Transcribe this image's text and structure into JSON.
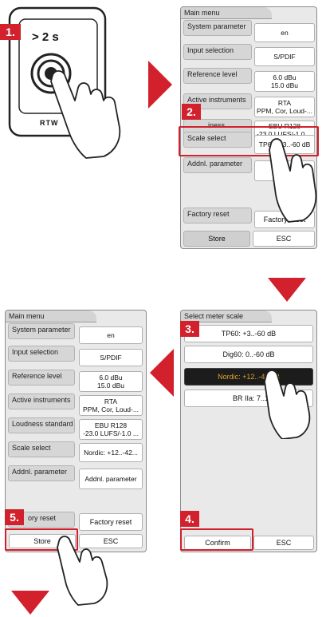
{
  "device": {
    "hold_label": "> 2 s",
    "brand": "RTW"
  },
  "steps": {
    "s1": "1.",
    "s2": "2.",
    "s3": "3.",
    "s4a": "4.",
    "s4b": "4.",
    "s5": "5."
  },
  "screen1": {
    "title": "Main menu",
    "rows": [
      {
        "label": "System parameter",
        "value": [
          "en"
        ]
      },
      {
        "label": "Input selection",
        "value": [
          "S/PDIF"
        ]
      },
      {
        "label": "Reference level",
        "value": [
          "6.0 dBu",
          "15.0 dBu"
        ]
      },
      {
        "label": "Active instruments",
        "value": [
          "RTA",
          "PPM, Cor, Loud-..."
        ]
      },
      {
        "label": "iness standard",
        "value": [
          "EBU R128",
          "-23.0 LUFS/-1.0 ..."
        ]
      },
      {
        "label": "Scale select",
        "value": [
          "TP60: +3..-60 dB"
        ]
      },
      {
        "label": "Addnl. parameter",
        "value": [
          "Addnl."
        ]
      }
    ],
    "factory_label": "Factory reset",
    "factory_button": "Factory reset",
    "store": "Store",
    "esc": "ESC"
  },
  "screen2": {
    "title": "Select meter scale",
    "options": [
      "TP60: +3..-60 dB",
      "Dig60: 0..-60 dB",
      "Nordic: +12..-42 dB",
      "BR IIa: 7..1"
    ],
    "confirm": "Confirm",
    "esc": "ESC"
  },
  "screen3": {
    "title": "Main menu",
    "rows": [
      {
        "label": "System parameter",
        "value": [
          "en"
        ]
      },
      {
        "label": "Input selection",
        "value": [
          "S/PDIF"
        ]
      },
      {
        "label": "Reference level",
        "value": [
          "6.0 dBu",
          "15.0 dBu"
        ]
      },
      {
        "label": "Active instruments",
        "value": [
          "RTA",
          "PPM, Cor, Loud-..."
        ]
      },
      {
        "label": "Loudness standard",
        "value": [
          "EBU R128",
          "-23.0 LUFS/-1.0 ..."
        ]
      },
      {
        "label": "Scale select",
        "value": [
          "Nordic: +12..-42..."
        ]
      },
      {
        "label": "Addnl. parameter",
        "value": [
          "Addnl. parameter"
        ]
      }
    ],
    "factory_label": "ory reset",
    "factory_button": "Factory reset",
    "store": "Store",
    "esc": "ESC"
  },
  "colors": {
    "accent_red": "#d2202c",
    "selected_bg": "#1c1c1c",
    "selected_text": "#e0a62a"
  }
}
